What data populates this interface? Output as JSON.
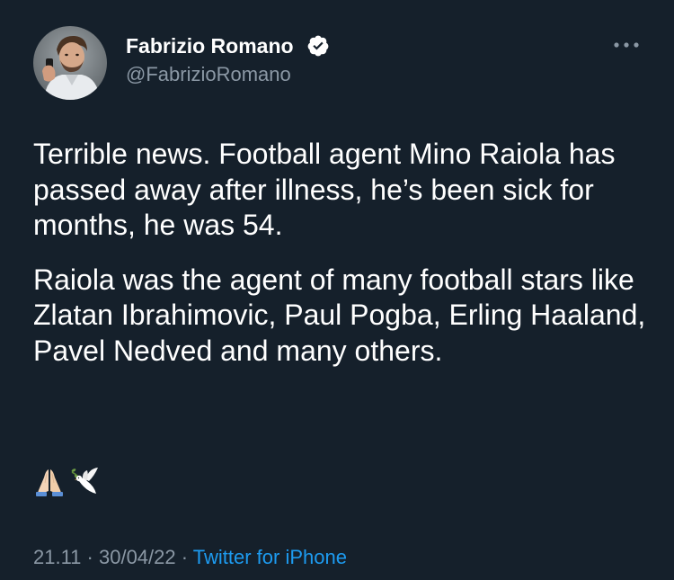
{
  "author": {
    "display_name": "Fabrizio Romano",
    "handle": "@FabrizioRomano",
    "verified": true,
    "avatar_icon": "profile-photo"
  },
  "menu": {
    "icon": "more-horizontal-icon"
  },
  "tweet": {
    "paragraphs": [
      "Terrible news. Football agent Mino Raiola has passed away after illness, he’s been sick for months, he was 54.",
      "Raiola was the agent of many football stars like Zlatan Ibrahimovic, Paul Pogba, Erling Haaland, Pavel Nedved and many others."
    ],
    "emojis": [
      "folded-hands-emoji",
      "dove-emoji"
    ]
  },
  "meta": {
    "time": "21.11",
    "separator": " · ",
    "date": "30/04/22",
    "source": "Twitter for iPhone"
  },
  "colors": {
    "background": "#15202b",
    "text": "#ffffff",
    "secondary_text": "#8b98a5",
    "link": "#1d9bf0"
  }
}
